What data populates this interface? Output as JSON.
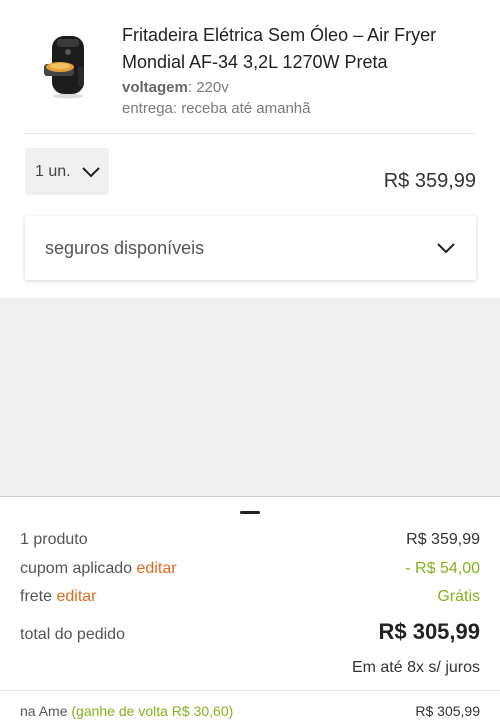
{
  "product": {
    "title": "Fritadeira Elétrica Sem Óleo – Air Fryer Mondial AF-34 3,2L 1270W Preta",
    "voltage_label": "voltagem",
    "voltage_value": ": 220v",
    "delivery": "entrega: receba até amanhã",
    "quantity": "1 un.",
    "price": "R$ 359,99",
    "image_icon": "air-fryer-image"
  },
  "insurance": {
    "label": "seguros disponíveis"
  },
  "summary": {
    "items_label": "1 produto",
    "items_value": "R$ 359,99",
    "coupon_label": "cupom aplicado",
    "coupon_edit": "editar",
    "coupon_value": "- R$ 54,00",
    "shipping_label": "frete",
    "shipping_edit": "editar",
    "shipping_value": "Grátis",
    "total_label": "total do pedido",
    "total_value": "R$ 305,99",
    "installments": "Em até 8x s/ juros",
    "ame_label": "na Ame",
    "ame_cashback": "(ganhe de volta R$ 30,60)",
    "ame_value": "R$ 305,99"
  },
  "colors": {
    "accent_orange": "#e06c1e",
    "discount_green": "#80b419"
  }
}
